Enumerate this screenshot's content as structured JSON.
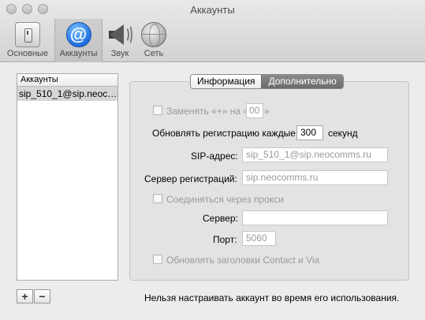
{
  "window": {
    "title": "Аккаунты"
  },
  "toolbar": {
    "items": [
      {
        "label": "Основные",
        "icon": "general-switch-icon"
      },
      {
        "label": "Аккаунты",
        "icon": "at-sign-icon"
      },
      {
        "label": "Звук",
        "icon": "speaker-icon"
      },
      {
        "label": "Сеть",
        "icon": "network-globe-icon"
      }
    ],
    "selected": "Аккаунты"
  },
  "accounts": {
    "header": "Аккаунты",
    "items": [
      "sip_510_1@sip.neocomms.ru"
    ],
    "add_label": "+",
    "remove_label": "−"
  },
  "tabs": {
    "info": "Информация",
    "advanced": "Дополнительно",
    "active": "Дополнительно"
  },
  "advanced": {
    "replace_plus_prefix": "Заменять «+» на «",
    "replace_plus_value": "00",
    "replace_plus_suffix": "»",
    "update_reg_prefix": "Обновлять регистрацию каждые",
    "update_reg_value": "300",
    "update_reg_suffix": "секунд",
    "sip_address_label": "SIP-адрес:",
    "sip_address_value": "sip_510_1@sip.neocomms.ru",
    "registrar_label": "Сервер регистраций:",
    "registrar_value": "sip.neocomms.ru",
    "use_proxy_label": "Соединяться через прокси",
    "server_label": "Сервер:",
    "server_value": "",
    "port_label": "Порт:",
    "port_value": "5060",
    "update_headers_label": "Обновлять заголовки Contact и Via"
  },
  "footer": {
    "message": "Нельзя настраивать аккаунт во время его использования."
  },
  "colors": {
    "window_bg": "#ececec",
    "selected_row": "#d6d6d6",
    "active_tab": "#7a7a7a",
    "disabled_text": "#9a9a9a"
  }
}
